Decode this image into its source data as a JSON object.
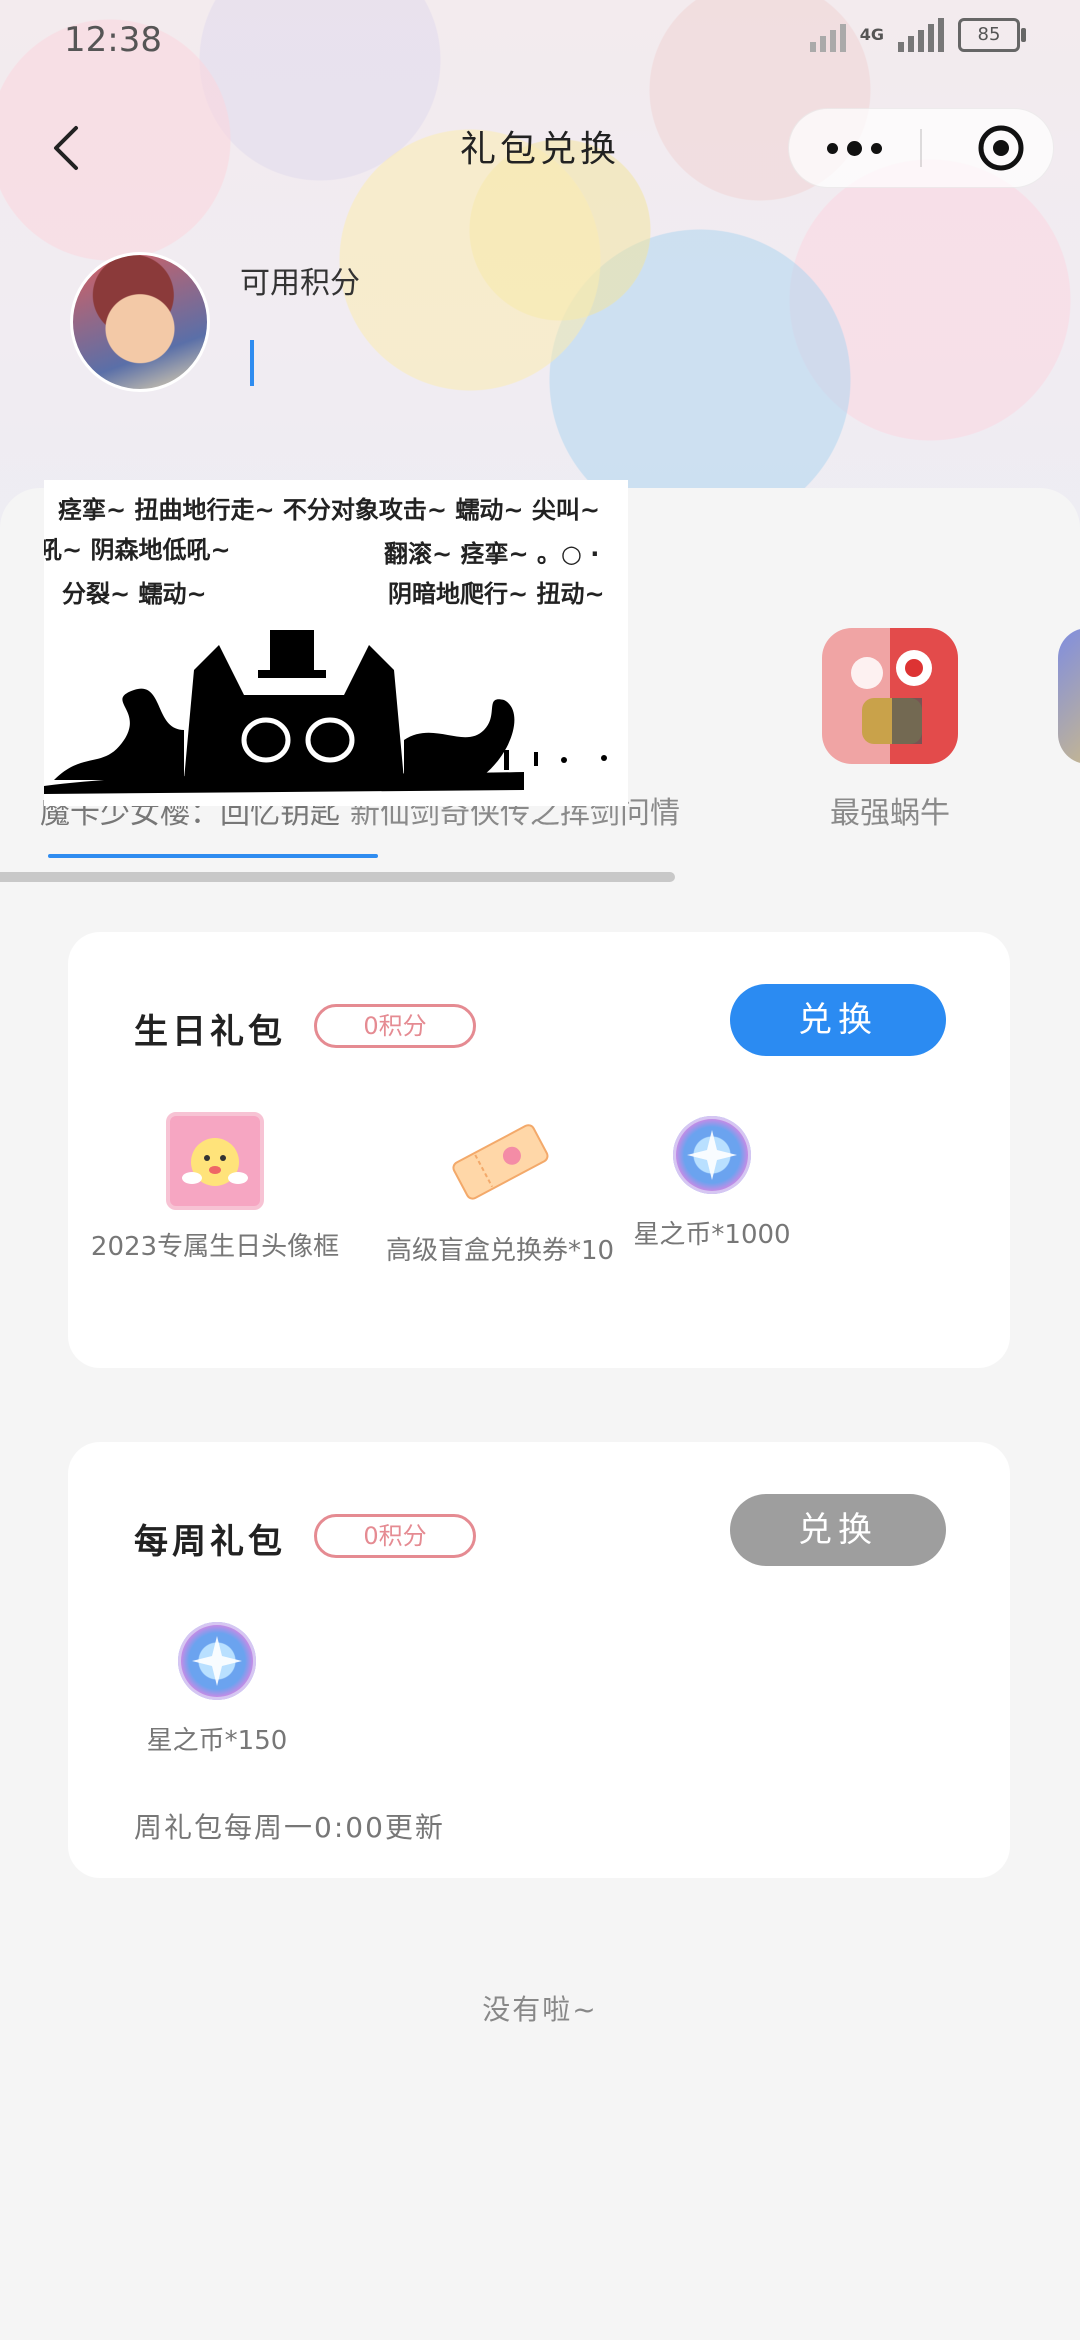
{
  "status_bar": {
    "time": "12:38",
    "network": "4G",
    "battery": "85"
  },
  "nav": {
    "title": "礼包兑换"
  },
  "profile": {
    "points_label": "可用积分",
    "points_value": ""
  },
  "games": [
    {
      "name": "魔卡少女樱：回忆钥匙",
      "active": true
    },
    {
      "name": "新仙剑奇侠传之挥剑问情",
      "active": false
    },
    {
      "name": "最强蜗牛",
      "active": false
    }
  ],
  "overlay_meme": {
    "lines": [
      "痉挛~ 扭曲地行走~ 不分对象攻击~ 蠕动~ 尖叫~",
      "吼~ 阴森地低吼~",
      "翻滚~ 痉挛~ 。○ ·",
      "分裂~ 蠕动~",
      "阴暗地爬行~ 扭动~"
    ]
  },
  "gift_packs": [
    {
      "title": "生日礼包",
      "points": "0积分",
      "button": "兑换",
      "button_state": "enabled",
      "items": [
        {
          "label": "2023专属生日头像框",
          "icon": "avatar-frame-icon"
        },
        {
          "label": "高级盲盒兑换券*10",
          "icon": "ticket-icon"
        },
        {
          "label": "星之币*1000",
          "icon": "star-coin-icon"
        }
      ]
    },
    {
      "title": "每周礼包",
      "points": "0积分",
      "button": "兑换",
      "button_state": "disabled",
      "items": [
        {
          "label": "星之币*150",
          "icon": "star-coin-icon"
        }
      ],
      "note": "周礼包每周一0:00更新"
    }
  ],
  "footer": {
    "end_text": "没有啦~"
  },
  "colors": {
    "accent": "#2b8bf2",
    "disabled": "#9e9e9e",
    "pill": "#e58b92",
    "background": "#f5f5f5"
  }
}
